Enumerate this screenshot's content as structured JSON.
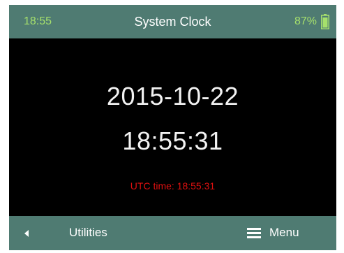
{
  "status_bar": {
    "time": "18:55",
    "title": "System Clock",
    "battery_percent": "87%",
    "battery_icon": "battery-icon"
  },
  "clock": {
    "date": "2015-10-22",
    "time": "18:55:31",
    "utc_text": "UTC time: 18:55:31"
  },
  "bottom_bar": {
    "back_icon": "left-arrow-icon",
    "back_label": "Utilities",
    "menu_icon": "hamburger-icon",
    "menu_label": "Menu"
  },
  "colors": {
    "bar_background": "#4f7b72",
    "status_green": "#a6e06c",
    "utc_red": "#e01010"
  }
}
